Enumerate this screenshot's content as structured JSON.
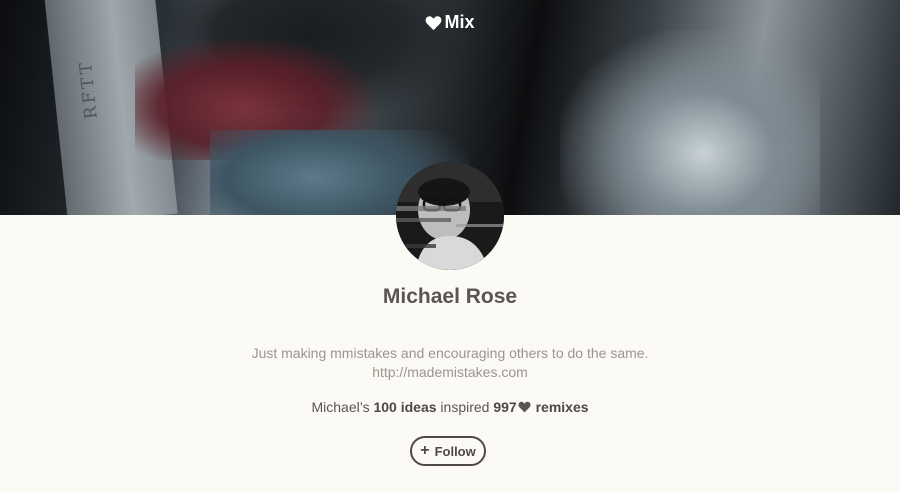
{
  "header": {
    "brand_label": "Mix",
    "brand_icon": "heart-icon",
    "hero_card_text": "RFTT"
  },
  "profile": {
    "name": "Michael Rose",
    "bio": "Just making mmistakes and encouraging others to do the same.",
    "website": "http://mademistakes.com",
    "stats": {
      "owner_prefix": "Michael’s",
      "ideas": "100 ideas",
      "inspired": "inspired",
      "remix_count": "997",
      "remixes": "remixes"
    }
  },
  "actions": {
    "follow_label": "Follow",
    "follow_icon": "plus-icon"
  },
  "colors": {
    "page_background": "#fcfaf5",
    "name_text": "#5a5550",
    "bio_text": "#9a9590",
    "button_border": "#4e4944"
  }
}
